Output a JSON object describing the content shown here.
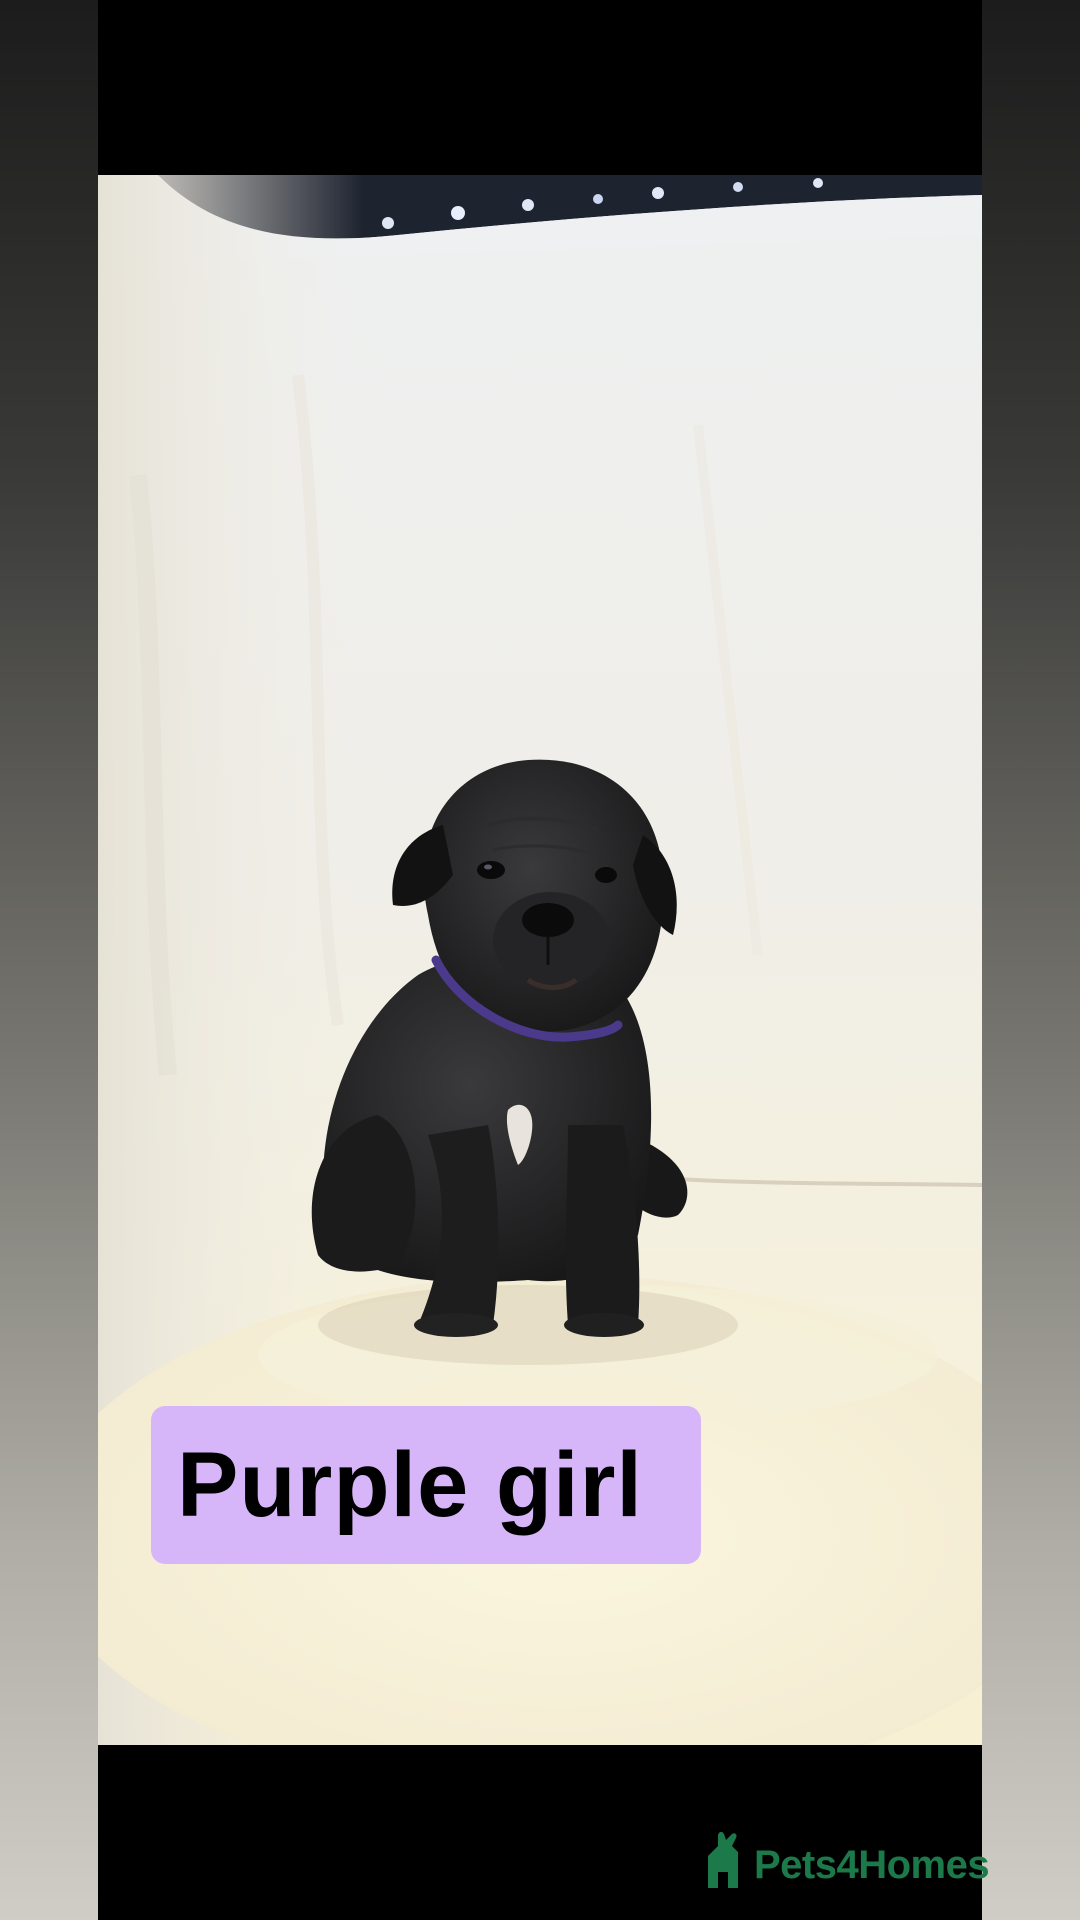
{
  "caption": {
    "text": "Purple girl",
    "background_color": "#d6b6f8",
    "text_color": "#000000"
  },
  "watermark": {
    "text": "Pets4Homes",
    "icon": "pets4homes-logo-icon",
    "color": "#1c7a4a"
  },
  "photo": {
    "subject": "black-puppy",
    "collar_color": "#4b3a8c",
    "blanket_color": "#f3efe2"
  }
}
